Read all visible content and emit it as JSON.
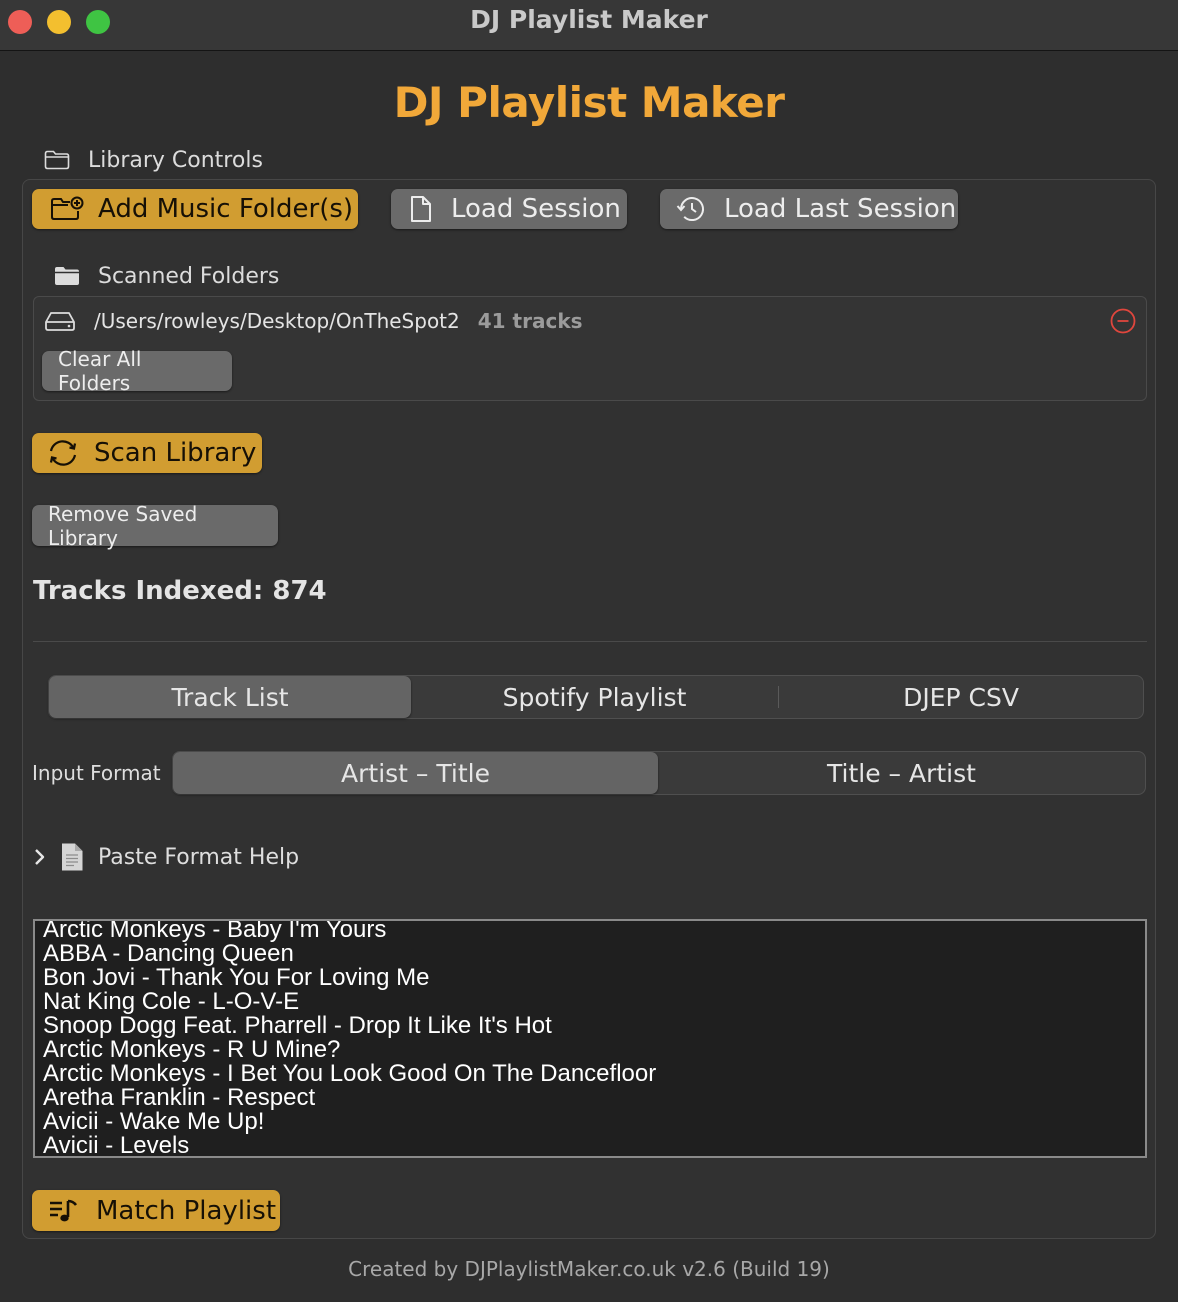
{
  "window": {
    "title": "DJ Playlist Maker",
    "traffic_lights": [
      "close",
      "minimize",
      "zoom"
    ]
  },
  "app": {
    "title": "DJ Playlist Maker",
    "accent_color": "#f1a839"
  },
  "library_controls": {
    "label": "Library Controls",
    "icon": "folder-icon",
    "buttons": {
      "add_folder": "Add Music Folder(s)",
      "load_session": "Load Session",
      "load_last_session": "Load Last Session"
    }
  },
  "scanned_folders": {
    "label": "Scanned Folders",
    "folders": [
      {
        "path": "/Users/rowleys/Desktop/OnTheSpot2",
        "count": "41 tracks"
      }
    ],
    "clear_all": "Clear All Folders"
  },
  "scan_library": "Scan Library",
  "remove_saved_library": "Remove Saved Library",
  "tracks_indexed": "Tracks Indexed: 874",
  "source_tabs": {
    "items": [
      "Track List",
      "Spotify Playlist",
      "DJEP CSV"
    ],
    "selected": "Track List"
  },
  "input_format": {
    "label": "Input Format",
    "options": [
      "Artist – Title",
      "Title – Artist"
    ],
    "selected": "Artist – Title"
  },
  "paste_help": {
    "label": "Paste Format Help",
    "expanded": false
  },
  "track_list": [
    "Arctic Monkeys - Baby I'm Yours",
    "ABBA - Dancing Queen",
    "Bon Jovi - Thank You For Loving Me",
    "Nat King Cole - L-O-V-E",
    "Snoop Dogg Feat. Pharrell - Drop It Like It's Hot",
    "Arctic Monkeys - R U Mine?",
    "Arctic Monkeys - I Bet You Look Good On The Dancefloor",
    "Aretha Franklin - Respect",
    "Avicii - Wake Me Up!",
    "Avicii - Levels"
  ],
  "match_playlist": "Match Playlist",
  "footer": "Created by DJPlaylistMaker.co.uk v2.6 (Build 19)",
  "colors": {
    "primary_button": "#d19d31",
    "secondary_button": "#6a6a6a",
    "remove_icon": "#e0463d"
  }
}
